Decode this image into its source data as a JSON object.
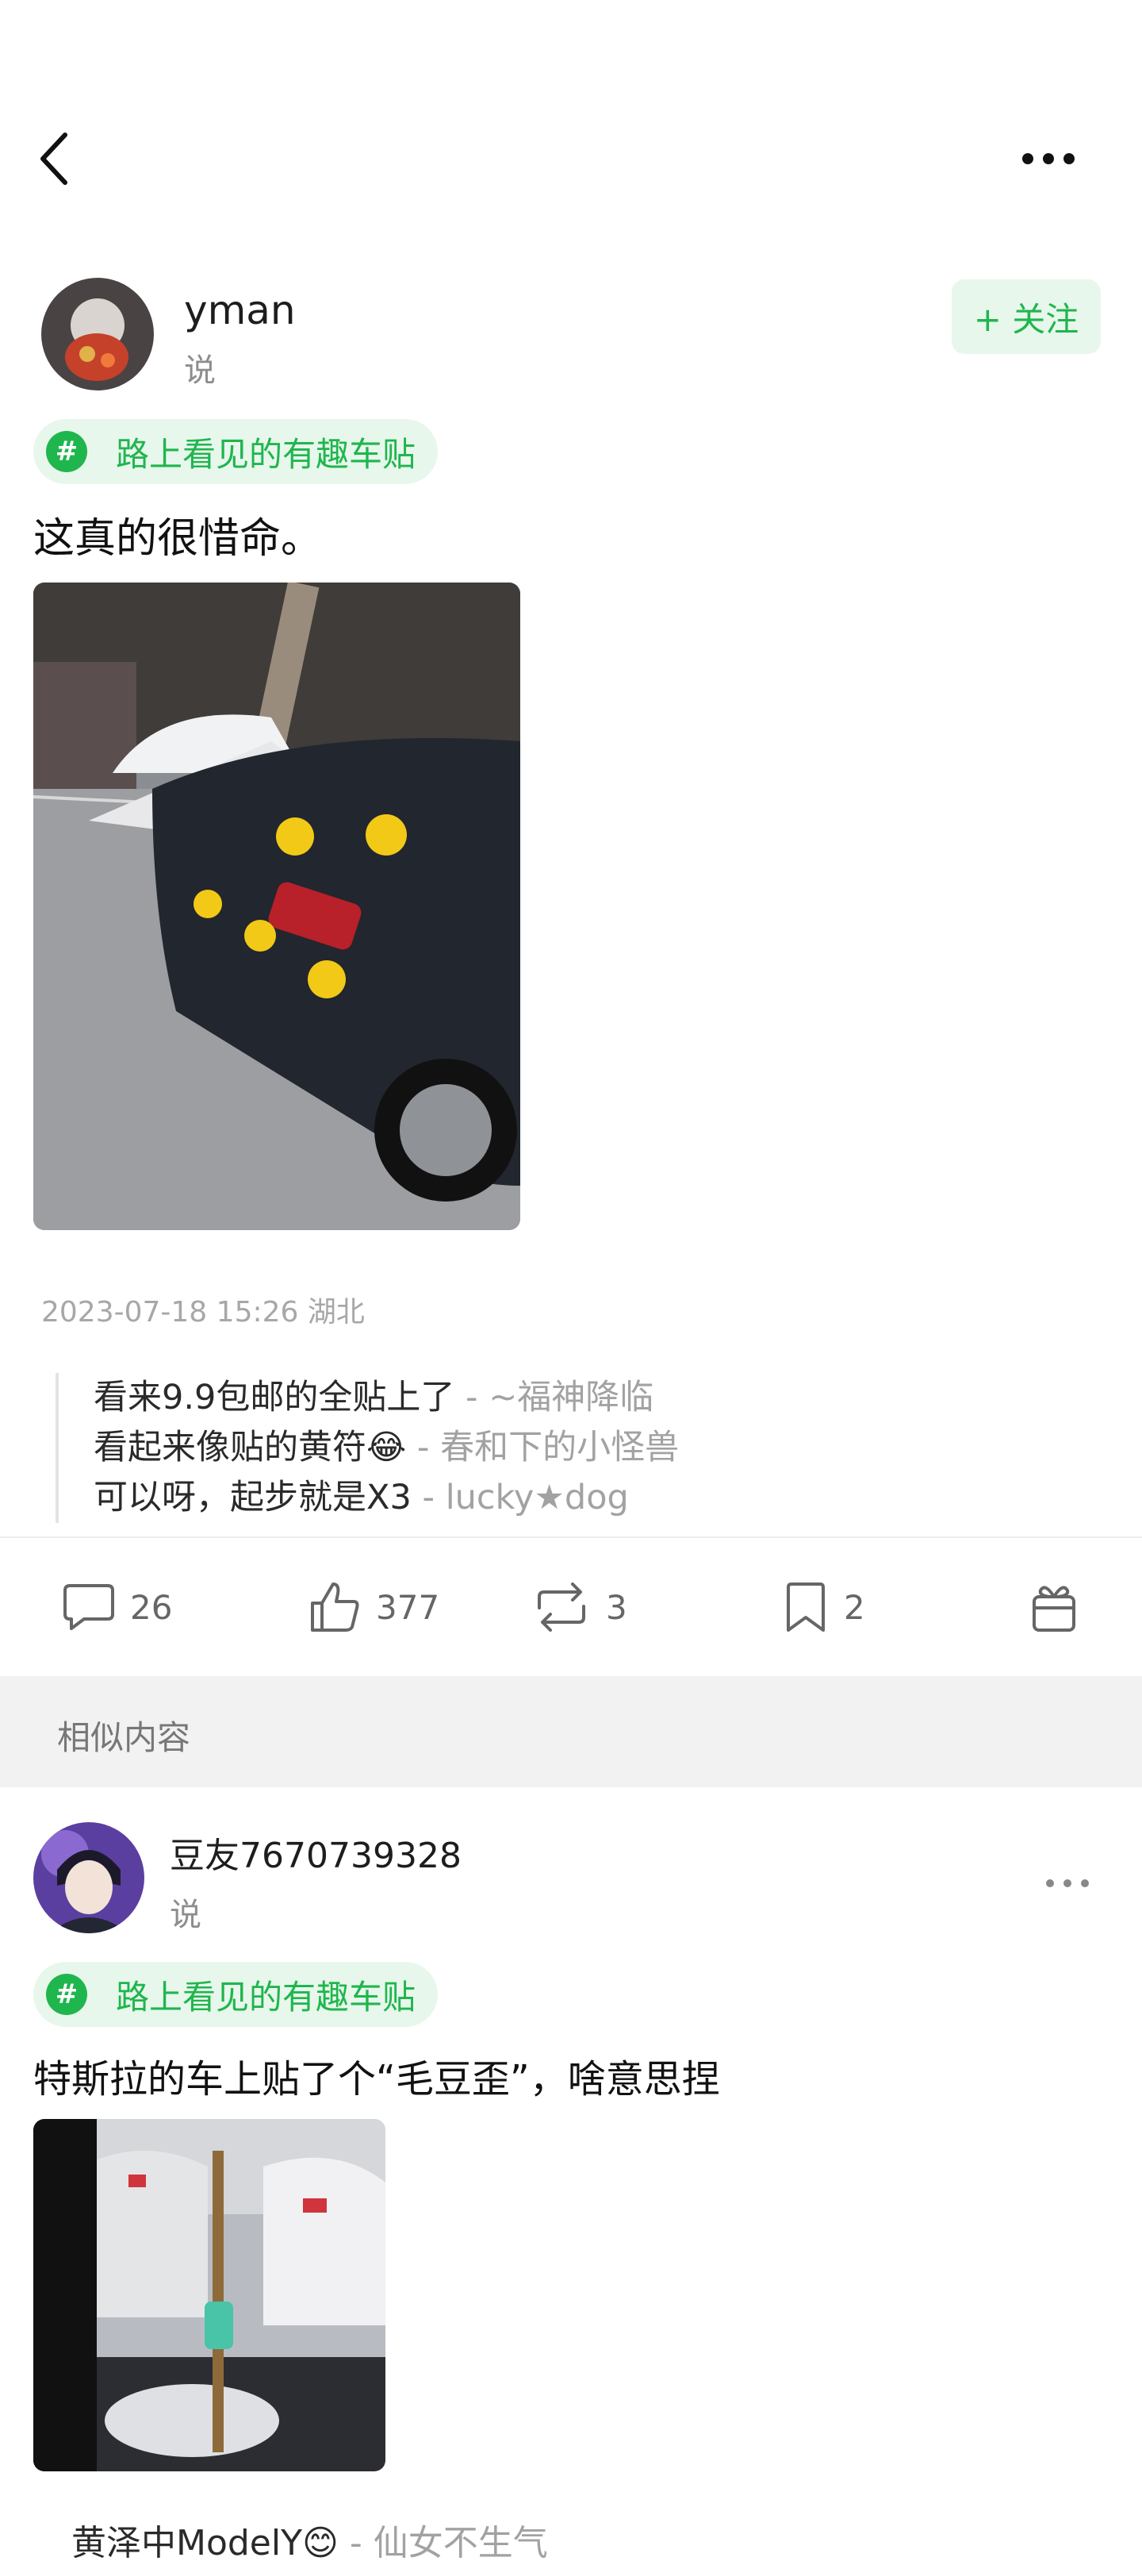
{
  "post": {
    "author": {
      "name": "yman",
      "subtitle": "说",
      "avatar": "avatar"
    },
    "follow_label": "+ 关注",
    "topic_tag": {
      "icon": "hashtag-icon",
      "label": "路上看见的有趣车贴"
    },
    "text": "这真的很惜命。",
    "image": "photo of black BMW X3 with yellow talisman stickers",
    "timestamp": "2023-07-18 15:26",
    "location": "湖北",
    "hot_comments": [
      {
        "text": "看来9.9包邮的全贴上了",
        "separator": " - ",
        "author": "~福神降临"
      },
      {
        "text": "看起来像贴的黄符😂",
        "separator": " - ",
        "author": "春和下的小怪兽"
      },
      {
        "text": "可以呀，起步就是X3",
        "separator": " - ",
        "author": "lucky★dog"
      }
    ],
    "actions": [
      {
        "icon": "comment-icon",
        "count": "26"
      },
      {
        "icon": "like-icon",
        "count": "377"
      },
      {
        "icon": "repost-icon",
        "count": "3"
      },
      {
        "icon": "bookmark-icon",
        "count": "2"
      },
      {
        "icon": "gift-icon",
        "count": ""
      }
    ]
  },
  "similar": {
    "title": "相似内容",
    "post": {
      "author": {
        "name": "豆友7670739328",
        "subtitle": "说"
      },
      "topic_tag": {
        "label": "路上看见的有趣车贴"
      },
      "text": "特斯拉的车上贴了个“毛豆歪”，啥意思捏",
      "partial_comment": {
        "text": "黄泽中ModelY😊",
        "separator": " - ",
        "author": "仙女不生气"
      }
    }
  },
  "colors": {
    "accent": "#1fb64e",
    "accent_bg": "#e8f7ec",
    "muted": "#a7a7a7"
  }
}
